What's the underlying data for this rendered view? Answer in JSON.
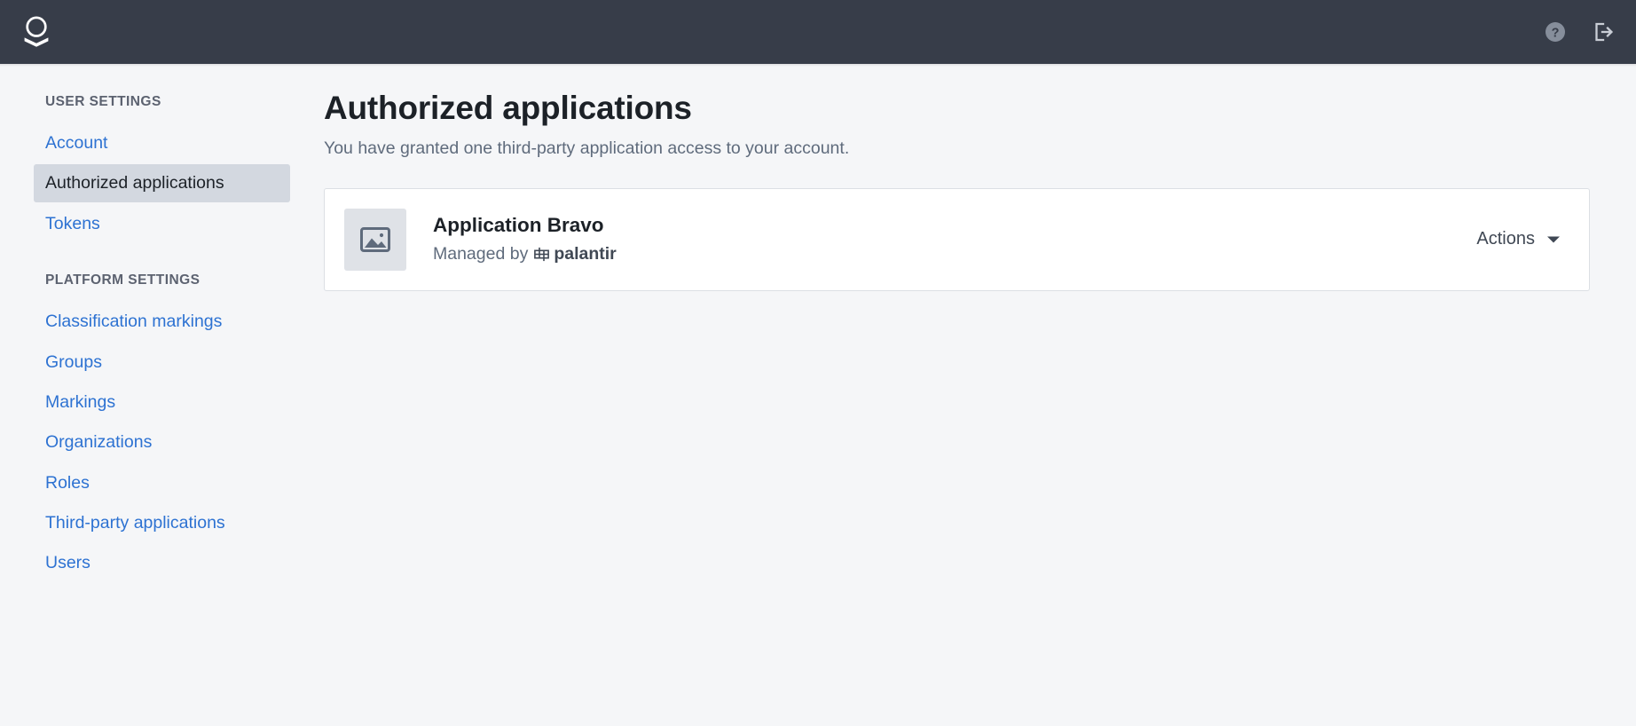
{
  "topbar": {
    "logo_name": "palantir-logo",
    "help_label": "Help",
    "logout_label": "Log out"
  },
  "sidebar": {
    "groups": [
      {
        "heading": "USER SETTINGS",
        "items": [
          {
            "label": "Account",
            "active": false
          },
          {
            "label": "Authorized applications",
            "active": true
          },
          {
            "label": "Tokens",
            "active": false
          }
        ]
      },
      {
        "heading": "PLATFORM SETTINGS",
        "items": [
          {
            "label": "Classification markings",
            "active": false
          },
          {
            "label": "Groups",
            "active": false
          },
          {
            "label": "Markings",
            "active": false
          },
          {
            "label": "Organizations",
            "active": false
          },
          {
            "label": "Roles",
            "active": false
          },
          {
            "label": "Third-party applications",
            "active": false
          },
          {
            "label": "Users",
            "active": false
          }
        ]
      }
    ]
  },
  "main": {
    "title": "Authorized applications",
    "subtitle": "You have granted one third-party application access to your account.",
    "applications": [
      {
        "name": "Application Bravo",
        "managed_by_prefix": "Managed by",
        "vendor": "palantir",
        "thumbnail_icon": "image-placeholder-icon",
        "actions_label": "Actions"
      }
    ]
  },
  "colors": {
    "topbar_bg": "#373d49",
    "link": "#2d72d2",
    "active_item_bg": "#d3d8e0",
    "page_bg": "#f5f6f8",
    "card_bg": "#ffffff",
    "card_border": "#dcdfe4",
    "muted_text": "#5f6b7c",
    "heading_text": "#1c2127"
  }
}
